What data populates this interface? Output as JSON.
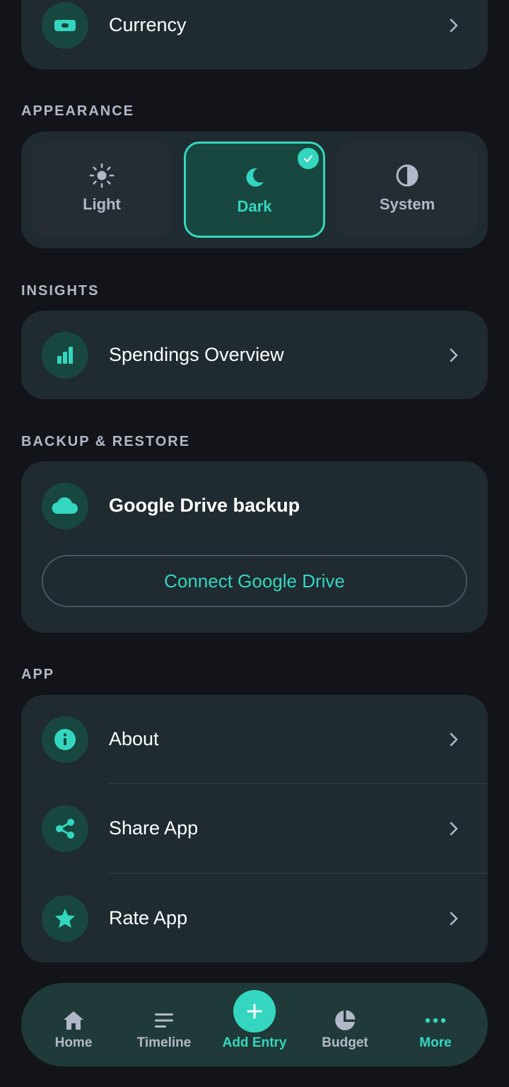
{
  "general": {
    "currency_label": "Currency"
  },
  "appearance": {
    "section_title": "APPEARANCE",
    "options": [
      {
        "label": "Light",
        "icon": "sun-icon"
      },
      {
        "label": "Dark",
        "icon": "moon-icon",
        "selected": true
      },
      {
        "label": "System",
        "icon": "half-circle-icon"
      }
    ]
  },
  "insights": {
    "section_title": "INSIGHTS",
    "spendings_label": "Spendings Overview"
  },
  "backup": {
    "section_title": "BACKUP & RESTORE",
    "google_drive_label": "Google Drive backup",
    "connect_button": "Connect Google Drive"
  },
  "app": {
    "section_title": "APP",
    "items": [
      {
        "label": "About",
        "icon": "info-icon"
      },
      {
        "label": "Share App",
        "icon": "share-icon"
      },
      {
        "label": "Rate App",
        "icon": "star-icon"
      }
    ]
  },
  "nav": {
    "items": [
      {
        "label": "Home",
        "icon": "home-icon"
      },
      {
        "label": "Timeline",
        "icon": "timeline-icon"
      },
      {
        "label": "Add Entry",
        "icon": "plus-icon"
      },
      {
        "label": "Budget",
        "icon": "pie-chart-icon"
      },
      {
        "label": "More",
        "icon": "more-icon",
        "active": true
      }
    ]
  },
  "colors": {
    "accent": "#35d6bf",
    "background": "#121419",
    "card": "#1f2a31",
    "icon_circle": "#18473f",
    "muted_text": "#b3b8c8"
  }
}
